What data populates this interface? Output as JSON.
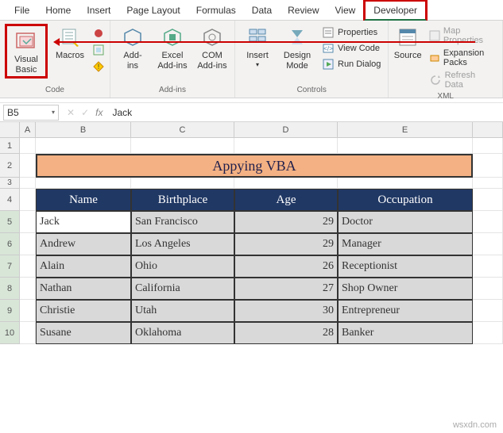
{
  "tabs": {
    "file": "File",
    "home": "Home",
    "insert": "Insert",
    "page_layout": "Page Layout",
    "formulas": "Formulas",
    "data": "Data",
    "review": "Review",
    "view": "View",
    "developer": "Developer"
  },
  "ribbon": {
    "code": {
      "label": "Code",
      "visual_basic": "Visual\nBasic",
      "macros": "Macros"
    },
    "addins": {
      "label": "Add-ins",
      "addins": "Add-\nins",
      "excel_addins": "Excel\nAdd-ins",
      "com_addins": "COM\nAdd-ins"
    },
    "controls": {
      "label": "Controls",
      "insert": "Insert",
      "design_mode": "Design\nMode",
      "properties": "Properties",
      "view_code": "View Code",
      "run_dialog": "Run Dialog"
    },
    "xml": {
      "label": "XML",
      "source": "Source",
      "map_properties": "Map Properties",
      "expansion_packs": "Expansion Packs",
      "refresh_data": "Refresh Data"
    }
  },
  "namebox": "B5",
  "formula_value": "Jack",
  "columns": [
    "A",
    "B",
    "C",
    "D",
    "E"
  ],
  "row_numbers": [
    "1",
    "2",
    "3",
    "4",
    "5",
    "6",
    "7",
    "8",
    "9",
    "10"
  ],
  "title": "Appying VBA",
  "headers": {
    "name": "Name",
    "birthplace": "Birthplace",
    "age": "Age",
    "occupation": "Occupation"
  },
  "rows": [
    {
      "name": "Jack",
      "birthplace": "San Francisco",
      "age": "29",
      "occupation": "Doctor"
    },
    {
      "name": "Andrew",
      "birthplace": "Los Angeles",
      "age": "29",
      "occupation": "Manager"
    },
    {
      "name": "Alain",
      "birthplace": "Ohio",
      "age": "26",
      "occupation": "Receptionist"
    },
    {
      "name": "Nathan",
      "birthplace": "California",
      "age": "27",
      "occupation": "Shop Owner"
    },
    {
      "name": "Christie",
      "birthplace": "Utah",
      "age": "30",
      "occupation": "Entrepreneur"
    },
    {
      "name": "Susane",
      "birthplace": "Oklahoma",
      "age": "28",
      "occupation": "Banker"
    }
  ],
  "watermark": "wsxdn.com"
}
